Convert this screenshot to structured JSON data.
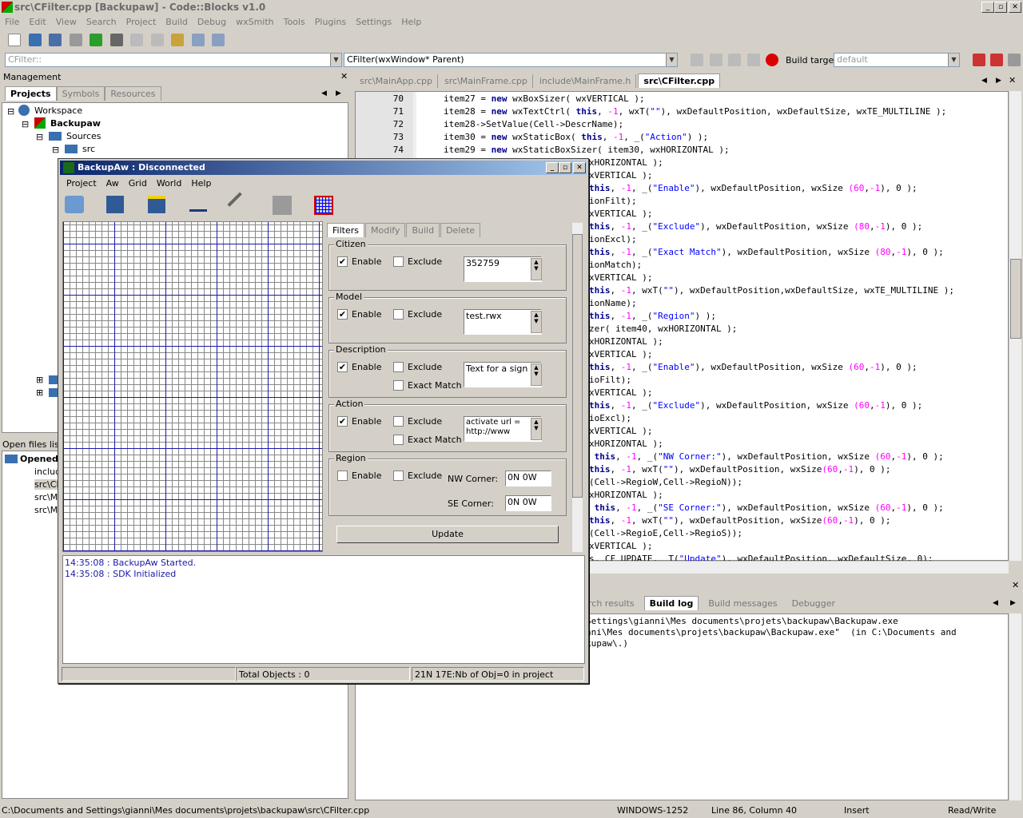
{
  "window": {
    "title": "src\\CFilter.cpp [Backupaw] - Code::Blocks v1.0"
  },
  "menu": [
    "File",
    "Edit",
    "View",
    "Search",
    "Project",
    "Build",
    "Debug",
    "wxSmith",
    "Tools",
    "Plugins",
    "Settings",
    "Help"
  ],
  "scope_combo": "CFilter::",
  "function_combo": "CFilter(wxWindow* Parent)",
  "build_target": {
    "label": "Build target:",
    "value": "default"
  },
  "management": {
    "title": "Management",
    "tabs": [
      "Projects",
      "Symbols",
      "Resources"
    ],
    "tree": {
      "workspace": "Workspace",
      "project": "Backupaw",
      "sources": "Sources",
      "src": "src"
    }
  },
  "open_files": {
    "title": "Open files list",
    "root": "Opened f",
    "items": [
      "include",
      "src\\CF",
      "src\\Ma",
      "src\\Ma"
    ]
  },
  "editor_tabs": [
    "src\\MainApp.cpp",
    "src\\MainFrame.cpp",
    "include\\MainFrame.h",
    "src\\CFilter.cpp"
  ],
  "code_lines": [
    {
      "n": "70",
      "t": "item27 = new wxBoxSizer( wxVERTICAL );"
    },
    {
      "n": "71",
      "t": "item28 = new wxTextCtrl( this, -1, wxT(\"\"), wxDefaultPosition, wxDefaultSize, wxTE_MULTILINE );"
    },
    {
      "n": "72",
      "t": "item28->SetValue(Cell->DescrName);"
    },
    {
      "n": "73",
      "t": "item30 = new wxStaticBox( this, -1, _(\"Action\") );"
    },
    {
      "n": "74",
      "t": "item29 = new wxStaticBoxSizer( item30, wxHORIZONTAL );"
    }
  ],
  "code_right": [
    "xHORIZONTAL );",
    "xVERTICAL );",
    "this, -1, _(\"Enable\"), wxDefaultPosition, wxSize (60,-1), 0 );",
    "ionFilt);",
    "xVERTICAL );",
    "this, -1, _(\"Exclude\"), wxDefaultPosition, wxSize (80,-1), 0 );",
    "ionExcl);",
    "this, -1, _(\"Exact Match\"), wxDefaultPosition, wxSize (80,-1), 0 );",
    "ionMatch);",
    "xVERTICAL );",
    "this, -1, wxT(\"\"), wxDefaultPosition,wxDefaultSize, wxTE_MULTILINE );",
    "ionName);",
    "this, -1, _(\"Region\") );",
    "zer( item40, wxHORIZONTAL );",
    "xHORIZONTAL );",
    "xVERTICAL );",
    "this, -1, _(\"Enable\"), wxDefaultPosition, wxSize (60,-1), 0 );",
    "ioFilt);",
    "xVERTICAL );",
    "this, -1, _(\"Exclude\"), wxDefaultPosition, wxSize (60,-1), 0 );",
    "ioExcl);",
    "xVERTICAL );",
    "xHORIZONTAL );",
    " this, -1, _(\"NW Corner:\"), wxDefaultPosition, wxSize (60,-1), 0 );",
    "this, -1, wxT(\"\"), wxDefaultPosition, wxSize(60,-1), 0 );",
    "(Cell->RegioW,Cell->RegioN));",
    "xHORIZONTAL );",
    " this, -1, _(\"SE Corner:\"), wxDefaultPosition, wxSize (60,-1), 0 );",
    "this, -1, wxT(\"\"), wxDefaultPosition, wxSize(60,-1), 0 );",
    "(Cell->RegioE,Cell->RegioS));",
    "xVERTICAL );",
    "s, CF_UPDATE, _T(\"Update\"), wxDefaultPosition, wxDefaultSize, 0);"
  ],
  "log_tabs": [
    "rch results",
    "Build log",
    "Build messages",
    "Debugger"
  ],
  "build_log": [
    "Settings\\gianni\\Mes documents\\projets\\backupaw\\Backupaw.exe",
    "nni\\Mes documents\\projets\\backupaw\\Backupaw.exe\"  (in C:\\Documents and",
    "kupaw\\.)"
  ],
  "status": {
    "path": "C:\\Documents and Settings\\gianni\\Mes documents\\projets\\backupaw\\src\\CFilter.cpp",
    "encoding": "WINDOWS-1252",
    "pos": "Line 86, Column 40",
    "mode": "Insert",
    "rw": "Read/Write"
  },
  "dialog": {
    "title": "BackupAw : Disconnected",
    "menu": [
      "Project",
      "Aw",
      "Grid",
      "World",
      "Help"
    ],
    "tabs": [
      "Filters",
      "Modify",
      "Build",
      "Delete"
    ],
    "groups": {
      "citizen": {
        "label": "Citizen",
        "enable": "Enable",
        "exclude": "Exclude",
        "value": "352759"
      },
      "model": {
        "label": "Model",
        "enable": "Enable",
        "exclude": "Exclude",
        "value": "test.rwx"
      },
      "description": {
        "label": "Description",
        "enable": "Enable",
        "exclude": "Exclude",
        "exact": "Exact Match",
        "value": "Text for a sign"
      },
      "action": {
        "label": "Action",
        "enable": "Enable",
        "exclude": "Exclude",
        "exact": "Exact Match",
        "value": "activate url =\nhttp://www"
      },
      "region": {
        "label": "Region",
        "enable": "Enable",
        "exclude": "Exclude",
        "nw_label": "NW Corner:",
        "nw_value": "0N 0W",
        "se_label": "SE Corner:",
        "se_value": "0N 0W"
      }
    },
    "update": "Update",
    "log": [
      "14:35:08 : BackupAw Started.",
      "14:35:08 : SDK Initialized"
    ],
    "status_objects": "Total Objects : 0",
    "status_info": "21N 17E:Nb of Obj=0 in project"
  }
}
